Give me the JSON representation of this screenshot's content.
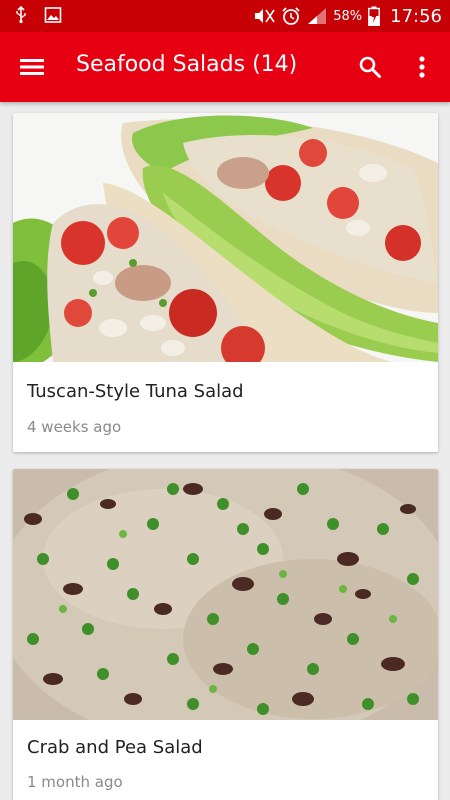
{
  "status_bar": {
    "battery": "58%",
    "time": "17:56",
    "icons": [
      "usb-icon",
      "image-icon",
      "mute-icon",
      "alarm-icon",
      "signal-icon",
      "battery-charging-icon"
    ]
  },
  "app_bar": {
    "title": "Seafood Salads (14)",
    "background": "#e60011",
    "status_background": "#c70006"
  },
  "recipes": [
    {
      "title": "Tuscan-Style Tuna Salad",
      "meta": "4 weeks ago"
    },
    {
      "title": "Crab and Pea Salad",
      "meta": "1 month ago"
    }
  ]
}
